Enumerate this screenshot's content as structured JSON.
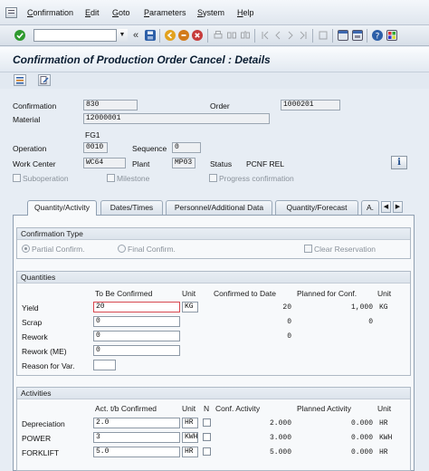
{
  "menu": {
    "items": [
      {
        "label": "Confirmation",
        "accel": "C",
        "rest": "onfirmation"
      },
      {
        "label": "Edit",
        "accel": "E",
        "rest": "dit"
      },
      {
        "label": "Goto",
        "accel": "G",
        "rest": "oto"
      },
      {
        "label": "Parameters",
        "accel": "P",
        "rest": "arameters"
      },
      {
        "label": "System",
        "accel": "S",
        "rest": "ystem"
      },
      {
        "label": "Help",
        "accel": "H",
        "rest": "elp"
      }
    ]
  },
  "toolbar": {
    "command_value": "",
    "back_chevron": "«",
    "colors": {
      "ok": "#2f9a2f",
      "save": "#2d5fa8",
      "back": "#e2a21f",
      "exit": "#d27a1a",
      "cancel": "#c63b3b"
    }
  },
  "title": "Confirmation of Production Order Cancel : Details",
  "header": {
    "confirmation_label": "Confirmation",
    "confirmation_value": "830",
    "order_label": "Order",
    "order_value": "1000201",
    "material_label": "Material",
    "material_value": "12000001",
    "material_desc": "FG1",
    "operation_label": "Operation",
    "operation_value": "0010",
    "sequence_label": "Sequence",
    "sequence_value": "0",
    "work_center_label": "Work Center",
    "work_center_value": "WC64",
    "plant_label": "Plant",
    "plant_value": "MP03",
    "status_label": "Status",
    "status_value": "PCNF REL",
    "suboperation_label": "Suboperation",
    "milestone_label": "Milestone",
    "progress_label": "Progress confirmation",
    "info_button": "i"
  },
  "tabs": [
    {
      "label": "Quantity/Activity",
      "active": true
    },
    {
      "label": "Dates/Times",
      "active": false
    },
    {
      "label": "Personnel/Additional Data",
      "active": false
    },
    {
      "label": "Quantity/Forecast",
      "active": false
    },
    {
      "label": "A.",
      "active": false
    }
  ],
  "tab_arrows": {
    "left": "◀",
    "right": "▶"
  },
  "confirmation_type": {
    "title": "Confirmation Type",
    "partial": "Partial Confirm.",
    "final": "Final Confirm.",
    "clear": "Clear Reservation",
    "selected": "partial"
  },
  "quantities": {
    "title": "Quantities",
    "col_to_be_confirmed": "To Be Confirmed",
    "col_unit": "Unit",
    "col_confirmed_to_date": "Confirmed to Date",
    "col_planned": "Planned for Conf.",
    "col_unit2": "Unit",
    "rows": [
      {
        "label": "Yield",
        "value": "20",
        "unit": "KG",
        "confirmed": "20",
        "planned": "1,000",
        "unit2": "KG"
      },
      {
        "label": "Scrap",
        "value": "0",
        "unit": "",
        "confirmed": "0",
        "planned": "0",
        "unit2": ""
      },
      {
        "label": "Rework",
        "value": "0",
        "unit": "",
        "confirmed": "0",
        "planned": "",
        "unit2": ""
      },
      {
        "label": "Rework (ME)",
        "value": "0",
        "unit": "",
        "confirmed": "",
        "planned": "",
        "unit2": ""
      }
    ],
    "reason_label": "Reason for Var.",
    "reason_value": ""
  },
  "activities": {
    "title": "Activities",
    "col_act": "Act. t/b Confirmed",
    "col_unit": "Unit",
    "col_n": "N",
    "col_conf": "Conf. Activity",
    "col_planned": "Planned Activity",
    "col_unit2": "Unit",
    "rows": [
      {
        "label": "Depreciation",
        "value": "2.0",
        "unit": "HR",
        "conf": "2.000",
        "planned": "0.000",
        "unit2": "HR"
      },
      {
        "label": "POWER",
        "value": "3",
        "unit": "KWH",
        "conf": "3.000",
        "planned": "0.000",
        "unit2": "KWH"
      },
      {
        "label": "FORKLIFT",
        "value": "5.0",
        "unit": "HR",
        "conf": "5.000",
        "planned": "0.000",
        "unit2": "HR"
      }
    ]
  }
}
